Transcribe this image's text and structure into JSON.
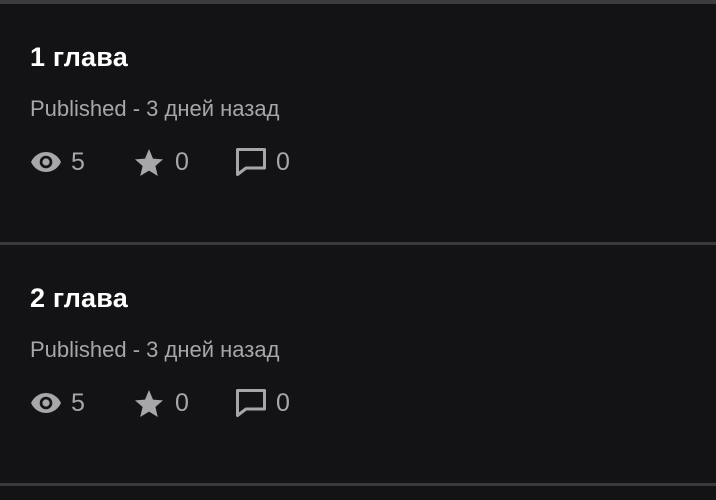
{
  "chapters": [
    {
      "title": "1 глава",
      "meta": "Published - 3 дней назад",
      "views": "5",
      "votes": "0",
      "comments": "0"
    },
    {
      "title": "2 глава",
      "meta": "Published - 3 дней назад",
      "views": "5",
      "votes": "0",
      "comments": "0"
    }
  ],
  "icons": {
    "views": "eye-icon",
    "votes": "star-icon",
    "comments": "comment-icon"
  },
  "colors": {
    "background": "#131214",
    "title": "#ffffff",
    "secondary_text": "#a7a6a9",
    "divider": "#3a393c"
  }
}
